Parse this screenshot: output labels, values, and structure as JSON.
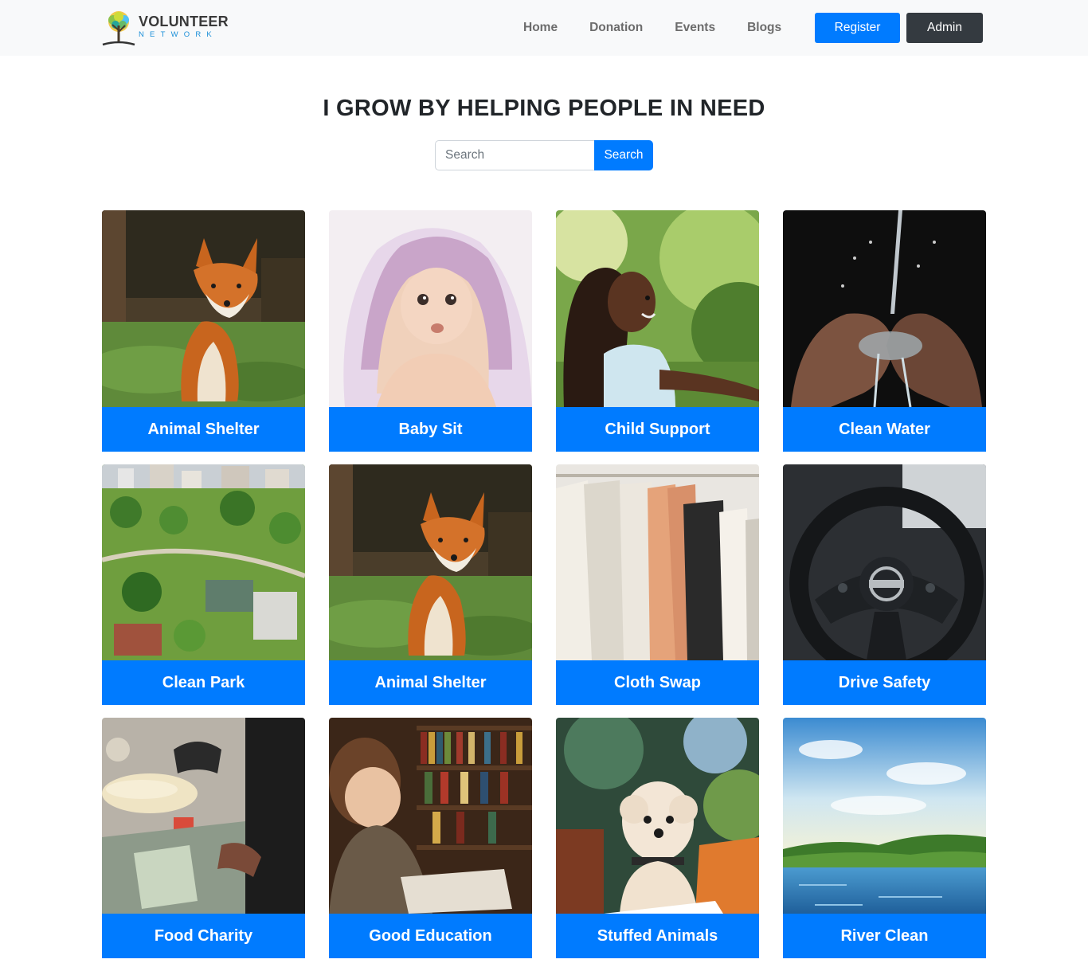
{
  "brand": {
    "name": "VOLUNTEER",
    "tagline": "NETWORK"
  },
  "nav": {
    "items": [
      "Home",
      "Donation",
      "Events",
      "Blogs"
    ],
    "register_label": "Register",
    "admin_label": "Admin"
  },
  "hero": {
    "title": "I GROW BY HELPING PEOPLE IN NEED"
  },
  "search": {
    "placeholder": "Search",
    "button_label": "Search"
  },
  "colors": {
    "primary": "#007bff",
    "dark": "#343a40",
    "navbar_bg": "#f8f9fa"
  },
  "cards": [
    {
      "label": "Animal Shelter",
      "image": "fox"
    },
    {
      "label": "Baby Sit",
      "image": "baby"
    },
    {
      "label": "Child Support",
      "image": "child"
    },
    {
      "label": "Clean Water",
      "image": "water"
    },
    {
      "label": "Clean Park",
      "image": "park"
    },
    {
      "label": "Animal Shelter",
      "image": "fox"
    },
    {
      "label": "Cloth Swap",
      "image": "clothes"
    },
    {
      "label": "Drive Safety",
      "image": "steering"
    },
    {
      "label": "Food Charity",
      "image": "food"
    },
    {
      "label": "Good Education",
      "image": "books"
    },
    {
      "label": "Stuffed Animals",
      "image": "dog"
    },
    {
      "label": "River Clean",
      "image": "river"
    }
  ]
}
